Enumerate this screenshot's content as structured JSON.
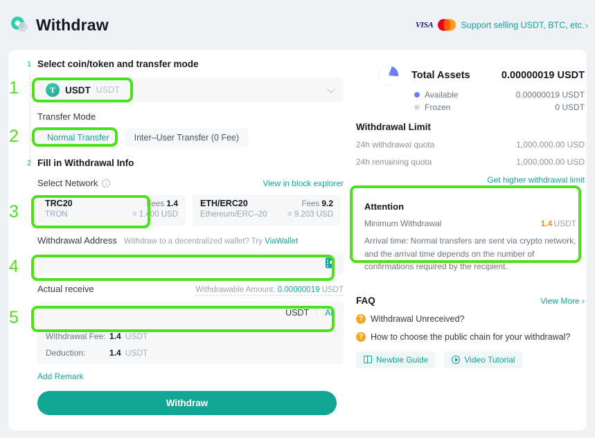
{
  "header": {
    "title": "Withdraw",
    "logo_icon": "withdraw-logo-icon",
    "visa_label": "VISA",
    "mastercard_icon": "mastercard-icon",
    "support_link": "Support selling USDT, BTC, etc.",
    "support_chevron": "›"
  },
  "left": {
    "step1_num": "1",
    "step1_title": "Select coin/token and transfer mode",
    "token": {
      "icon_letter": "T",
      "name": "USDT",
      "sub": "USDT"
    },
    "transfer_mode_label": "Transfer Mode",
    "modes": [
      {
        "label": "Normal Transfer",
        "active": true
      },
      {
        "label": "Inter–User Transfer (0 Fee)",
        "active": false
      }
    ],
    "step2_num": "2",
    "step2_title": "Fill in Withdrawal Info",
    "select_network_label": "Select Network",
    "info_icon_char": "i",
    "explorer_link": "View in block explorer",
    "networks": [
      {
        "name": "TRC20",
        "sub": "TRON",
        "fee_label": "Fees",
        "fee_value": "1.4",
        "usd": "= 1.400 USD",
        "selected": true
      },
      {
        "name": "ETH/ERC20",
        "sub": "Ethereum/ERC–20",
        "fee_label": "Fees",
        "fee_value": "9.2",
        "usd": "= 9.203 USD",
        "selected": false
      }
    ],
    "address_label": "Withdrawal Address",
    "address_hint_pre": "Withdraw to a decentralized wallet? Try ",
    "address_hint_link": "ViaWallet",
    "address_value": "",
    "address_placeholder": "",
    "address_book_icon": "address-book-icon",
    "actual_receive_label": "Actual receive",
    "withdrawable_label": "Withdrawable Amount: ",
    "withdrawable_value": "0.00000019",
    "withdrawable_unit": " USDT",
    "amount_value": "",
    "amount_unit": "USDT",
    "amount_all": "All",
    "fees": [
      {
        "key": "Withdrawal Fee:",
        "value": "1.4",
        "unit": "USDT"
      },
      {
        "key": "Deduction:",
        "value": "1.4",
        "unit": "USDT"
      }
    ],
    "add_remark": "Add Remark",
    "withdraw_button": "Withdraw"
  },
  "right": {
    "pie_icon": "assets-pie-chart-icon",
    "total_assets_label": "Total Assets",
    "total_assets_value": "0.00000019 USDT",
    "legend": [
      {
        "label": "Available",
        "value": "0.00000019 USDT",
        "color": "#6c7ef5"
      },
      {
        "label": "Frozen",
        "value": "0 USDT",
        "color": "#d6dbe2"
      }
    ],
    "limit_title": "Withdrawal Limit",
    "limits": [
      {
        "key": "24h withdrawal quota",
        "value": "1,000,000.00 USD"
      },
      {
        "key": "24h remaining quota",
        "value": "1,000,000.00 USD"
      }
    ],
    "limit_link": "Get higher withdrawal limit",
    "attention": {
      "title": "Attention",
      "min_label": "Minimum Withdrawal",
      "min_value": "1.4",
      "min_unit": "USDT",
      "body": "Arrival time: Normal transfers are sent via crypto network, and the arrival time depends on the number of confirmations required by the recipient."
    },
    "faq_title": "FAQ",
    "faq_more": "View More ›",
    "faq_items": [
      {
        "icon_char": "?",
        "text": "Withdrawal Unreceived?"
      },
      {
        "icon_char": "?",
        "text": "How to choose the public chain for your withdrawal?"
      }
    ],
    "pills": [
      {
        "icon": "book-icon",
        "label": "Newbie Guide"
      },
      {
        "icon": "play-circle-icon",
        "label": "Video Tutorial"
      }
    ]
  },
  "annotations": {
    "color": "#4ee01e",
    "numbers": [
      "1",
      "2",
      "3",
      "4",
      "5"
    ]
  }
}
